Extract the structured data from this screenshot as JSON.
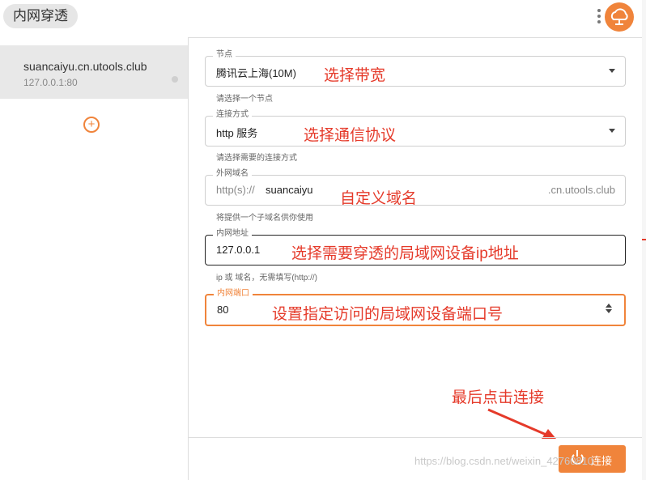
{
  "app": {
    "title": "内网穿透"
  },
  "sidebar": {
    "item": {
      "domain": "suancaiyu.cn.utools.club",
      "address": "127.0.0.1:80"
    },
    "add_icon": "plus-circle-icon"
  },
  "form": {
    "node": {
      "label": "节点",
      "value": "腾讯云上海(10M)",
      "helper": "请选择一个节点"
    },
    "protocol": {
      "label": "连接方式",
      "value": "http 服务",
      "helper": "请选择需要的连接方式"
    },
    "domain": {
      "label": "外网域名",
      "prefix": "http(s)://",
      "value": "suancaiyu",
      "suffix": ".cn.utools.club",
      "helper": "将提供一个子域名供你使用"
    },
    "address": {
      "label": "内网地址",
      "value": "127.0.0.1",
      "helper": "ip 或 域名，无需填写(http://)"
    },
    "port": {
      "label": "内网端口",
      "value": "80"
    }
  },
  "annotations": {
    "bandwidth": "选择带宽",
    "protocol": "选择通信协议",
    "domain": "自定义域名",
    "address": "选择需要穿透的局域网设备ip地址",
    "port": "设置指定访问的局域网设备端口号",
    "connect": "最后点击连接"
  },
  "connect_button": {
    "label": "连接"
  },
  "watermark": "https://blog.csdn.net/weixin_42760810",
  "colors": {
    "accent": "#f0843b",
    "annotation": "#e53a2a"
  }
}
